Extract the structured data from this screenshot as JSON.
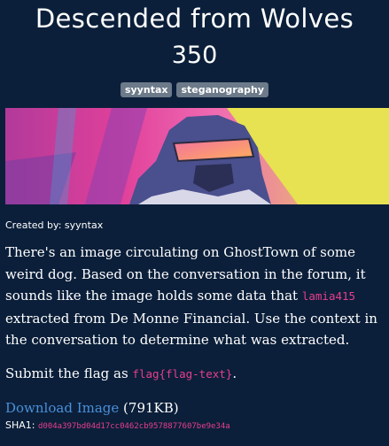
{
  "challenge": {
    "title": "Descended from Wolves",
    "points": "350",
    "tags": [
      "syyntax",
      "steganography"
    ]
  },
  "banner": {
    "colors": {
      "yellow": "#e6e251",
      "magenta": "#d9338f",
      "pink": "#f06bb2",
      "purple": "#7a3ea3",
      "blue": "#3aa6d9"
    }
  },
  "meta": {
    "created_by": "Created by: syyntax"
  },
  "description": {
    "part1": "There's an image circulating on GhostTown of some weird dog. Based on the conversation in the forum, it sounds like the image holds some data that ",
    "user_code": "lamia415",
    "part2": " extracted from De Monne Financial. Use the context in the conversation to determine what was extracted."
  },
  "submit": {
    "prefix": "Submit the flag as ",
    "flag_format": "flag{flag-text}",
    "suffix": "."
  },
  "download": {
    "link_label": "Download Image",
    "size": " (791KB)"
  },
  "hash": {
    "label": "SHA1: ",
    "value": "d004a397bd04d17cc0462cb9578877607be9e34a"
  },
  "colors": {
    "background": "#0b1f3a",
    "link": "#4a90d9",
    "code": "#e83e8c",
    "tag_bg": "#6c7a89"
  }
}
